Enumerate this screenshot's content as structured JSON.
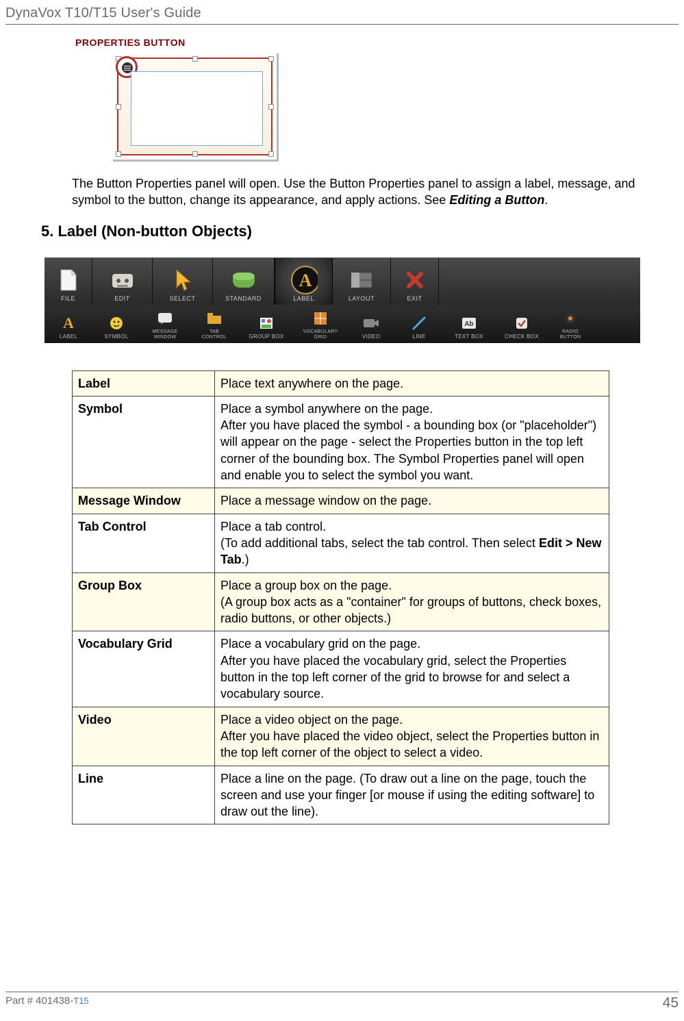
{
  "header": {
    "title": "DynaVox T10/T15 User's Guide"
  },
  "section": {
    "label": "PROPERTIES BUTTON"
  },
  "paragraph": {
    "text_a": "The Button Properties panel will open. Use the Button Properties panel to assign a label, message, and symbol to the button, change its appearance, and apply actions. See ",
    "link": "Editing a Button",
    "text_b": "."
  },
  "heading": "5. Label (Non-button Objects)",
  "toolbar_top": [
    {
      "name": "file",
      "label": "FILE"
    },
    {
      "name": "edit",
      "label": "EDIT"
    },
    {
      "name": "select",
      "label": "SELECT"
    },
    {
      "name": "standard",
      "label": "STANDARD"
    },
    {
      "name": "label",
      "label": "LABEL"
    },
    {
      "name": "layout",
      "label": "LAYOUT"
    },
    {
      "name": "exit",
      "label": "EXIT"
    }
  ],
  "toolbar_bottom": [
    {
      "name": "label",
      "label": "LABEL"
    },
    {
      "name": "symbol",
      "label": "SYMBOL"
    },
    {
      "name": "message-window",
      "label": "MESSAGE WINDOW"
    },
    {
      "name": "tab-control",
      "label": "TAB CONTROL"
    },
    {
      "name": "group-box",
      "label": "GROUP BOX"
    },
    {
      "name": "vocabulary-grid",
      "label": "VOCABULARY GRID"
    },
    {
      "name": "video",
      "label": "VIDEO"
    },
    {
      "name": "line",
      "label": "LINE"
    },
    {
      "name": "text-box",
      "label": "TEXT BOX"
    },
    {
      "name": "check-box",
      "label": "CHECK BOX"
    },
    {
      "name": "radio-button",
      "label": "RADIO BUTTON"
    }
  ],
  "table": [
    {
      "term": "Label",
      "desc": "Place text anywhere on the page.",
      "tint": true
    },
    {
      "term": "Symbol",
      "desc": "Place a symbol anywhere on the page.\nAfter you have placed the symbol - a bounding box (or \"placeholder\") will appear on the page - select the Properties button in the top left corner of the bounding box. The Symbol Properties panel will open and enable you to select the symbol you want.",
      "tint": false
    },
    {
      "term": "Message Window",
      "desc": "Place a message window on the page.",
      "tint": true
    },
    {
      "term": "Tab Control",
      "desc_a": "Place a tab control.\n(To add additional tabs, select the tab control. Then select ",
      "bold": "Edit > New Tab",
      "desc_b": ".)",
      "tint": false
    },
    {
      "term": "Group Box",
      "desc": "Place a group box on the page.\n(A group box acts as a \"container\" for groups of buttons, check boxes, radio buttons, or other objects.)",
      "tint": true
    },
    {
      "term": "Vocabulary Grid",
      "desc": "Place a vocabulary grid on the page.\nAfter you have placed the vocabulary grid, select the Properties button in the top left corner of the grid to browse for and select a vocabulary source.",
      "tint": false
    },
    {
      "term": "Video",
      "desc": "Place a video object on the page.\nAfter you have placed the video object, select the Properties button in the top left corner of the object to select a video.",
      "tint": true
    },
    {
      "term": "Line",
      "desc": "Place a line on the page. (To draw out a line on the page, touch the screen and use your finger [or mouse if using the editing software] to draw out the line).",
      "tint": false
    }
  ],
  "footer": {
    "part_a": "Part # 401438-",
    "part_b": "T15",
    "page": "45"
  }
}
